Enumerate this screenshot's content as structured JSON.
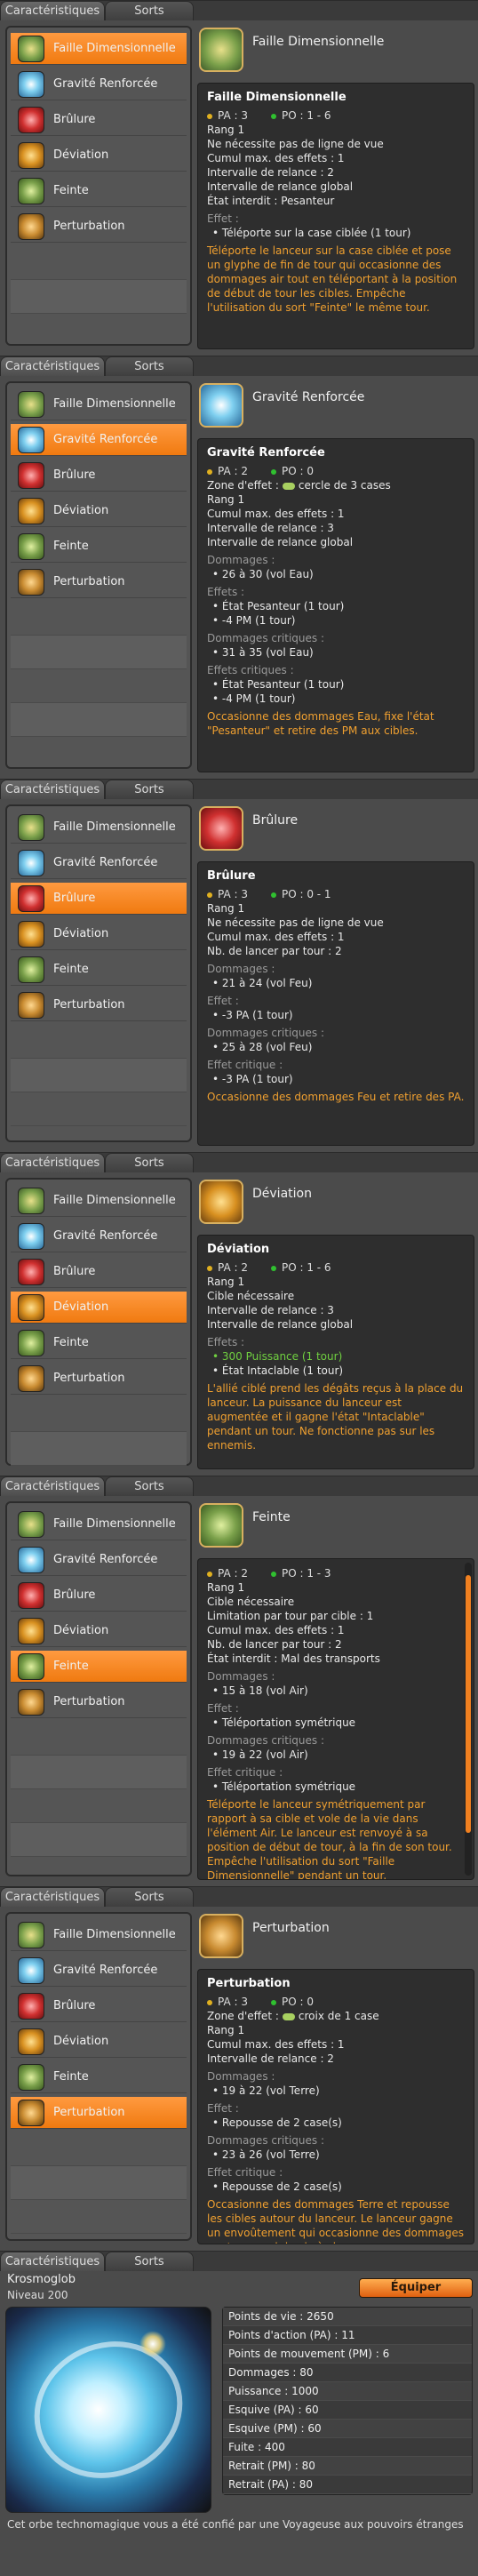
{
  "tabs": {
    "characteristics": "Caractéristiques",
    "spells": "Sorts"
  },
  "spells": [
    "Faille Dimensionnelle",
    "Gravité Renforcée",
    "Brûlure",
    "Déviation",
    "Feinte",
    "Perturbation"
  ],
  "panels": [
    {
      "active": 0,
      "name": "Faille Dimensionnelle",
      "title": "Faille Dimensionnelle",
      "pa": "PA : 3",
      "po": "PO : 1 - 6",
      "lines": [
        "Rang 1",
        "Ne nécessite pas de ligne de vue",
        "Cumul max. des effets : 1",
        "Intervalle de relance : 2",
        "Intervalle de relance global",
        "État interdit : Pesanteur"
      ],
      "effects_label": "Effet :",
      "effects": [
        "Téléporte sur la case ciblée (1 tour)"
      ],
      "description": "Téléporte le lanceur sur la case ciblée et pose un glyphe de fin de tour qui occasionne des dommages air tout en téléportant à la position de début de tour les cibles. Empêche l'utilisation du sort \"Feinte\" le même tour."
    },
    {
      "active": 1,
      "name": "Gravité Renforcée",
      "title": "Gravité Renforcée",
      "pa": "PA : 2",
      "po": "PO : 0",
      "zone_label": "Zone d'effet :",
      "zone_value": "cercle de 3 cases",
      "lines": [
        "Rang 1",
        "Cumul max. des effets : 1",
        "Intervalle de relance : 3",
        "Intervalle de relance global"
      ],
      "dmg_label": "Dommages :",
      "dmg": "26 à 30 (vol Eau)",
      "effects_label": "Effets :",
      "effects": [
        "État Pesanteur (1 tour)",
        "-4 PM (1 tour)"
      ],
      "crit_label": "Dommages critiques :",
      "crit": "31 à 35 (vol Eau)",
      "crit_eff_label": "Effets critiques :",
      "crit_effects": [
        "État Pesanteur (1 tour)",
        "-4 PM (1 tour)"
      ],
      "description": "Occasionne des dommages Eau, fixe l'état \"Pesanteur\" et retire des PM aux cibles."
    },
    {
      "active": 2,
      "name": "Brûlure",
      "title": "Brûlure",
      "pa": "PA : 3",
      "po": "PO : 0 - 1",
      "lines": [
        "Rang 1",
        "Ne nécessite pas de ligne de vue",
        "Cumul max. des effets : 1",
        "Nb. de lancer par tour : 2"
      ],
      "dmg_label": "Dommages :",
      "dmg": "21 à 24 (vol Feu)",
      "effects_label": "Effet :",
      "effects": [
        "-3 PA (1 tour)"
      ],
      "crit_label": "Dommages critiques :",
      "crit": "25 à 28 (vol Feu)",
      "crit_eff_label": "Effet critique :",
      "crit_effects": [
        "-3 PA (1 tour)"
      ],
      "description": "Occasionne des dommages Feu et retire des PA."
    },
    {
      "active": 3,
      "name": "Déviation",
      "title": "Déviation",
      "pa": "PA : 2",
      "po": "PO : 1 - 6",
      "lines": [
        "Rang 1",
        "Cible nécessaire",
        "Intervalle de relance : 3",
        "Intervalle de relance global"
      ],
      "effects_label": "Effets :",
      "effects_green": "300 Puissance (1 tour)",
      "effects": [
        "État Intaclable (1 tour)"
      ],
      "description": "L'allié ciblé prend les dégâts reçus à la place du lanceur. La puissance du lanceur est augmentée et il gagne l'état \"Intaclable\" pendant un tour. Ne fonctionne pas sur les ennemis."
    },
    {
      "active": 4,
      "name": "Feinte",
      "pa": "PA : 2",
      "po": "PO : 1 - 3",
      "lines": [
        "Rang 1",
        "Cible nécessaire",
        "Limitation par tour par cible : 1",
        "Cumul max. des effets : 1",
        "Nb. de lancer par tour : 2",
        "État interdit : Mal des transports"
      ],
      "dmg_label": "Dommages :",
      "dmg": "15 à 18 (vol Air)",
      "effects_label": "Effet :",
      "effects": [
        "Téléportation symétrique"
      ],
      "crit_label": "Dommages critiques :",
      "crit": "19 à 22 (vol Air)",
      "crit_eff_label": "Effet critique :",
      "crit_effects": [
        "Téléportation symétrique"
      ],
      "description": "Téléporte le lanceur symétriquement par rapport à sa cible et vole de la vie dans l'élément Air. Le lanceur est renvoyé à sa position de début de tour, à la fin de son tour. Empêche l'utilisation du sort \"Faille Dimensionnelle\" pendant un tour."
    },
    {
      "active": 5,
      "name": "Perturbation",
      "title": "Perturbation",
      "pa": "PA : 3",
      "po": "PO : 0",
      "zone_label": "Zone d'effet :",
      "zone_value": "croix de 1 case",
      "lines": [
        "Rang 1",
        "Cumul max. des effets : 1",
        "Intervalle de relance : 2"
      ],
      "dmg_label": "Dommages :",
      "dmg": "19 à 22 (vol Terre)",
      "effects_label": "Effet :",
      "effects": [
        "Repousse de 2 case(s)"
      ],
      "crit_label": "Dommages critiques :",
      "crit": "23 à 26 (vol Terre)",
      "crit_eff_label": "Effet critique :",
      "crit_effects": [
        "Repousse de 2 case(s)"
      ],
      "description": "Occasionne des dommages Terre et repousse les cibles autour du lanceur. Le lanceur gagne un envoûtement qui occasionne des dommages neutre en vol de vie à chaque coup reçu en mêlée pendant un tour."
    }
  ],
  "profile": {
    "name": "Krosmoglob",
    "level": "Niveau 200",
    "equip": "Équiper",
    "stats": [
      "Points de vie : 2650",
      "Points d'action (PA) : 11",
      "Points de mouvement (PM) : 6",
      "Dommages : 80",
      "Puissance : 1000",
      "Esquive (PA) : 60",
      "Esquive (PM) : 60",
      "Fuite : 400",
      "Retrait (PM) : 80",
      "Retrait (PA) : 80"
    ],
    "description": "Cet orbe technomagique vous a été confié par une Voyageuse aux pouvoirs étranges"
  }
}
